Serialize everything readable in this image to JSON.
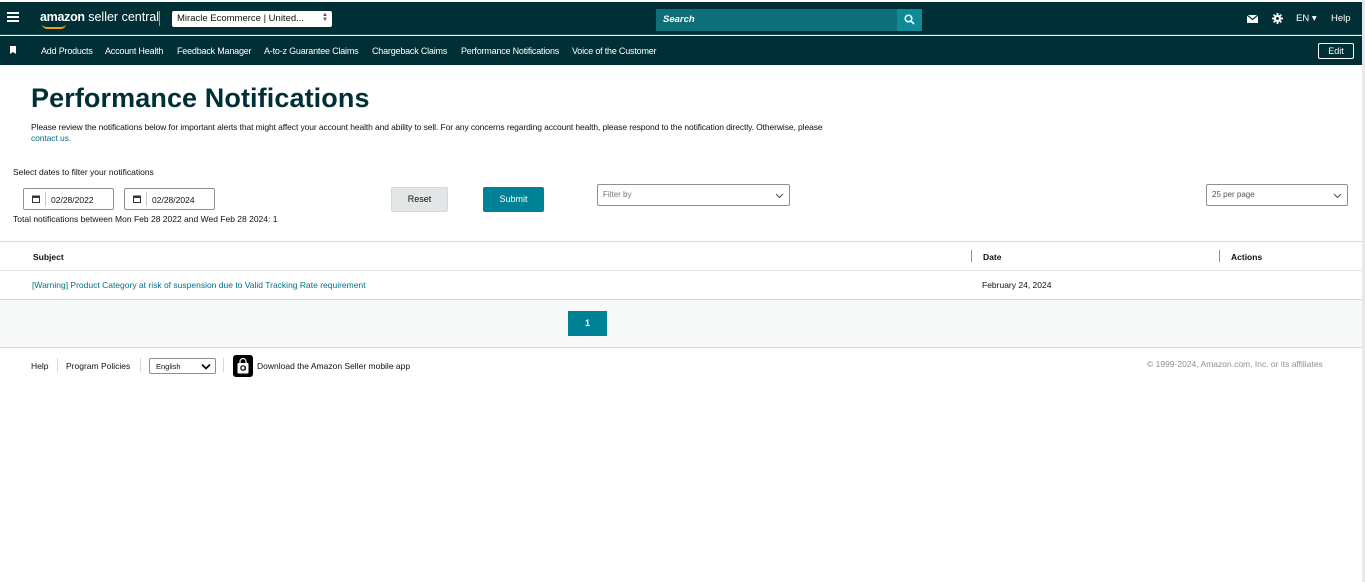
{
  "header": {
    "logo_text_bold": "amazon",
    "logo_text_rest": " seller central",
    "account_selector": "Miracle Ecommerce | United...",
    "search_placeholder": "Search",
    "language": "EN",
    "help": "Help"
  },
  "nav": {
    "items": [
      {
        "label": "Add Products"
      },
      {
        "label": "Account Health"
      },
      {
        "label": "Feedback Manager"
      },
      {
        "label": "A-to-z Guarantee Claims"
      },
      {
        "label": "Chargeback Claims"
      },
      {
        "label": "Performance Notifications"
      },
      {
        "label": "Voice of the Customer"
      }
    ],
    "edit_label": "Edit"
  },
  "page": {
    "title": "Performance Notifications",
    "intro_text": "Please review the notifications below for important alerts that might affect your account health and ability to sell. For any concerns regarding account health, please respond to the notification directly. Otherwise, please",
    "intro_link": "contact us.",
    "filter_label": "Select dates to filter your notifications",
    "start_date": "02/28/2022",
    "end_date": "02/28/2024",
    "total_text": "Total notifications between Mon Feb 28 2022 and Wed Feb 28 2024: 1",
    "reset_label": "Reset",
    "submit_label": "Submit",
    "filter_by_placeholder": "Filter by",
    "per_page": "25 per page"
  },
  "table": {
    "headers": {
      "subject": "Subject",
      "date": "Date",
      "actions": "Actions"
    },
    "rows": [
      {
        "subject": "[Warning] Product Category at risk of suspension due to Valid Tracking Rate requirement",
        "date": "February 24, 2024"
      }
    ]
  },
  "pagination": {
    "current_page": "1"
  },
  "footer": {
    "help": "Help",
    "program_policies": "Program Policies",
    "language": "English",
    "app_download": "Download the Amazon Seller mobile app",
    "copyright": "© 1999-2024, Amazon.com, Inc. or its affiliates"
  },
  "colors": {
    "header_bg": "#002f36",
    "accent": "#008296",
    "link": "#007185",
    "logo_smile": "#ff9900"
  }
}
